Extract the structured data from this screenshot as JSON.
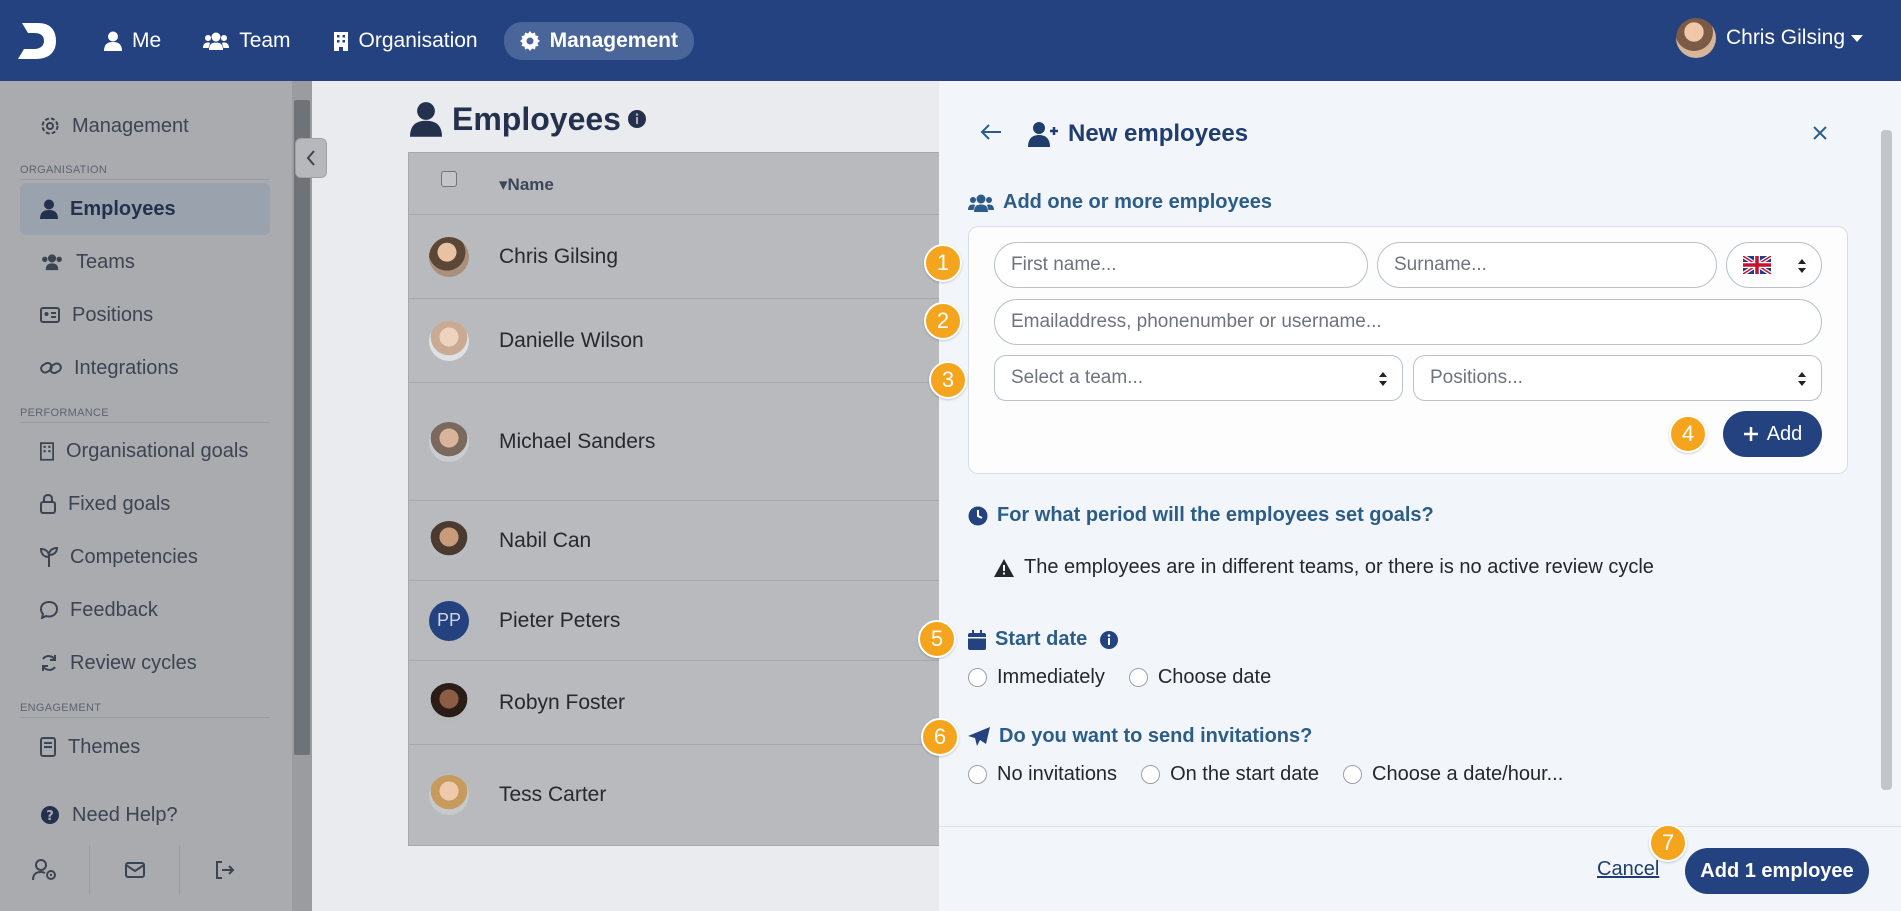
{
  "topbar": {
    "nav": [
      {
        "label": "Me",
        "icon": "user-icon"
      },
      {
        "label": "Team",
        "icon": "users-icon"
      },
      {
        "label": "Organisation",
        "icon": "building-icon"
      },
      {
        "label": "Management",
        "icon": "gear-icon",
        "active": true
      }
    ],
    "user_name": "Chris Gilsing"
  },
  "sidebar": {
    "top_item": "Management",
    "sections": [
      {
        "heading": "ORGANISATION",
        "items": [
          "Employees",
          "Teams",
          "Positions",
          "Integrations"
        ]
      },
      {
        "heading": "PERFORMANCE",
        "items": [
          "Organisational goals",
          "Fixed goals",
          "Competencies",
          "Feedback",
          "Review cycles"
        ]
      },
      {
        "heading": "ENGAGEMENT",
        "items": [
          "Themes"
        ]
      }
    ],
    "help": "Need Help?",
    "active_item": "Employees"
  },
  "main": {
    "title": "Employees",
    "table_header": "Name",
    "rows": [
      {
        "name": "Chris Gilsing"
      },
      {
        "name": "Danielle Wilson"
      },
      {
        "name": "Michael Sanders"
      },
      {
        "name": "Nabil Can"
      },
      {
        "name": "Pieter Peters",
        "initials": "PP"
      },
      {
        "name": "Robyn Foster"
      },
      {
        "name": "Tess Carter"
      }
    ]
  },
  "panel": {
    "title": "New employees",
    "add_section": "Add one or more employees",
    "first_name_placeholder": "First name...",
    "surname_placeholder": "Surname...",
    "email_placeholder": "Emailaddress, phonenumber or username...",
    "team_placeholder": "Select a team...",
    "positions_placeholder": "Positions...",
    "add_label": "Add",
    "period_heading": "For what period will the employees set goals?",
    "warning": "The employees are in different teams, or there is no active review cycle",
    "start_date_heading": "Start date",
    "start_options": [
      "Immediately",
      "Choose date"
    ],
    "invite_heading": "Do you want to send invitations?",
    "invite_options": [
      "No invitations",
      "On the start date",
      "Choose a date/hour..."
    ],
    "cancel_label": "Cancel",
    "submit_label": "Add 1 employee",
    "badges": [
      "1",
      "2",
      "3",
      "4",
      "5",
      "6",
      "7"
    ]
  },
  "colors": {
    "primary": "#24427f",
    "badge": "#f5a51d",
    "section_heading": "#2c5c88"
  }
}
